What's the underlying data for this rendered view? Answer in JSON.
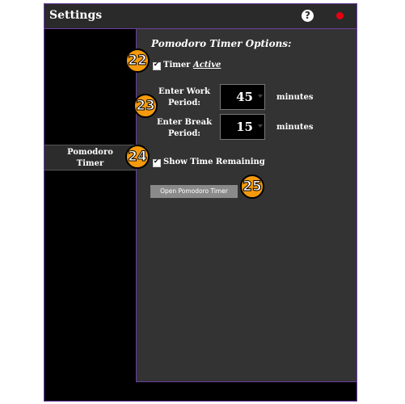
{
  "window": {
    "title": "Settings"
  },
  "sidebar": {
    "items": [
      {
        "label": "Pomodoro Timer",
        "line1": "Pomodoro",
        "line2": "Timer"
      }
    ]
  },
  "panel": {
    "title": "Pomodoro Timer Options:",
    "timer_active": {
      "label_prefix": "Timer",
      "label_emph": "Active",
      "checked": true
    },
    "work": {
      "label_line1": "Enter Work",
      "label_line2": "Period:",
      "value": "45",
      "unit": "minutes"
    },
    "break": {
      "label_line1": "Enter Break",
      "label_line2": "Period:",
      "value": "15",
      "unit": "minutes"
    },
    "show_remaining": {
      "label": "Show Time Remaining",
      "checked": true
    },
    "open_button": "Open Pomodoro Timer"
  },
  "badges": [
    "22",
    "23",
    "24",
    "25"
  ],
  "colors": {
    "accent": "#6b3fa0",
    "badge": "#f59a0c",
    "close": "#e8000f",
    "panel": "#333333"
  },
  "icons": {
    "help": "help-icon",
    "close": "close-icon"
  }
}
